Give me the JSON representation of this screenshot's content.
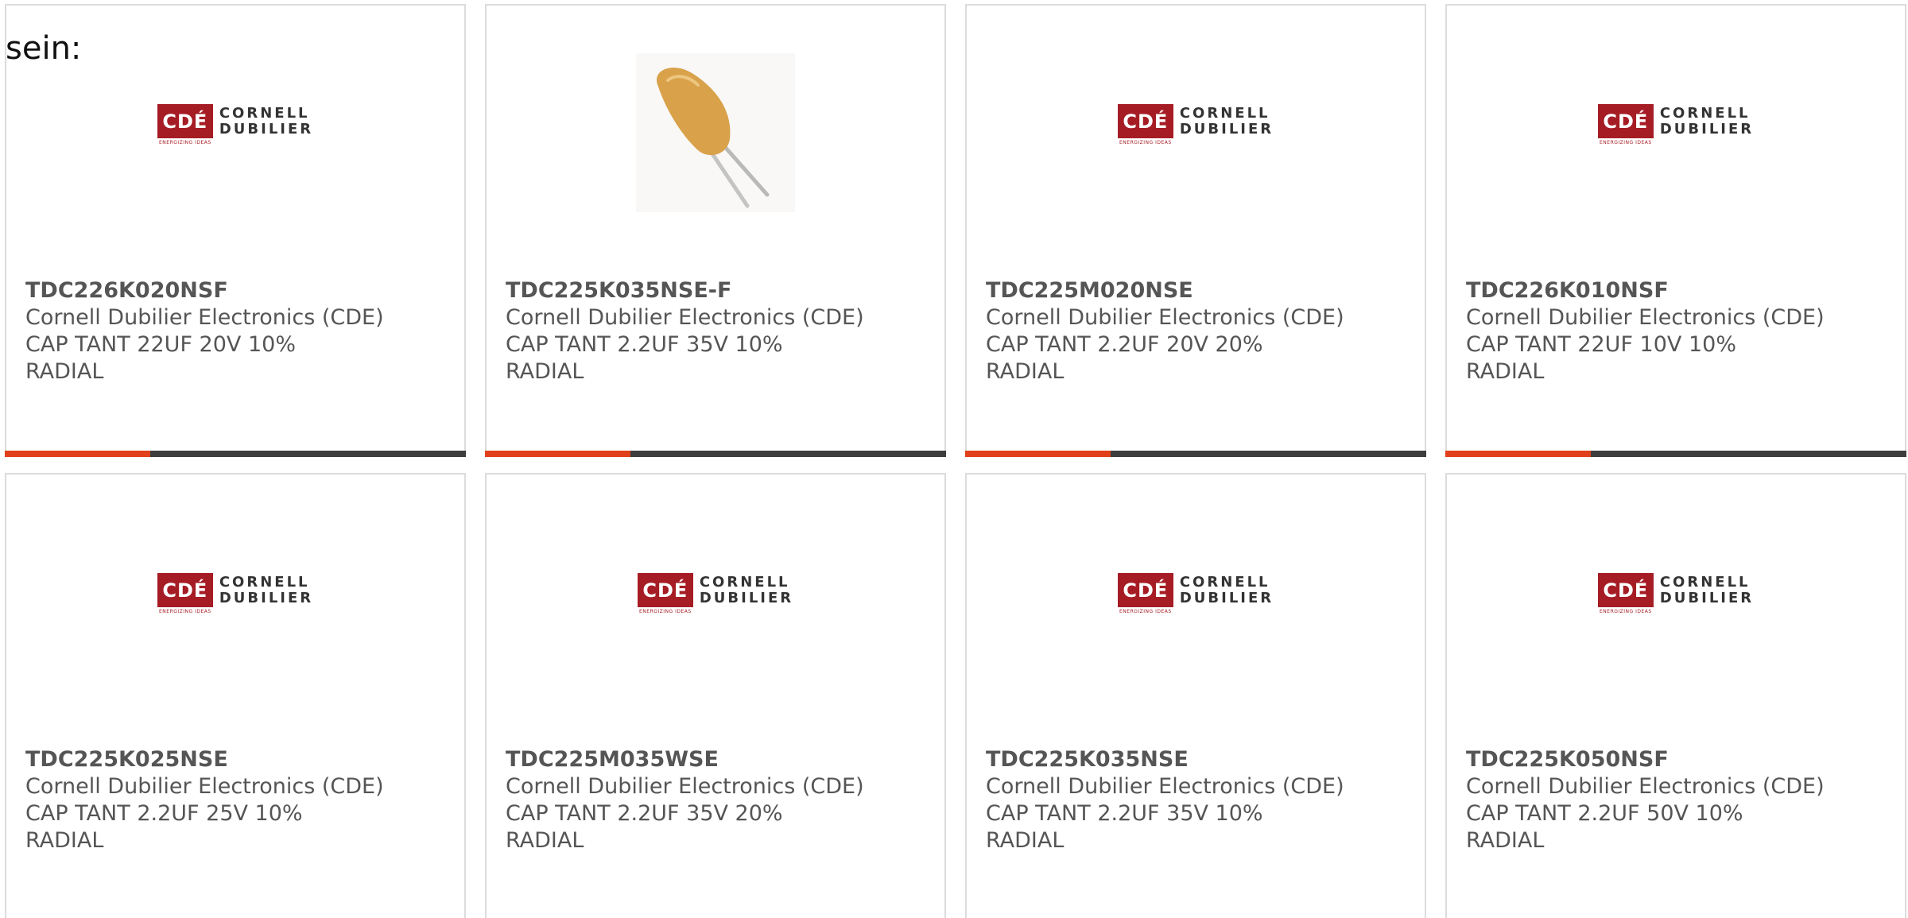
{
  "intro_text": "sein:",
  "colors": {
    "accent": "#e2401c",
    "bar": "#3d3d3d",
    "logo_red": "#a61c24",
    "capacitor_body": "#d9a14a"
  },
  "logo": {
    "mark": "CDÉ",
    "line1": "CORNELL",
    "line2": "DUBILIER",
    "tagline": "ENERGIZING IDEAS"
  },
  "products": [
    {
      "part_number": "TDC226K020NSF",
      "manufacturer": "Cornell Dubilier Electronics (CDE)",
      "desc_line1": "CAP TANT 22UF 20V 10%",
      "desc_line2": "RADIAL",
      "image": "cde-logo"
    },
    {
      "part_number": "TDC225K035NSE-F",
      "manufacturer": "Cornell Dubilier Electronics (CDE)",
      "desc_line1": "CAP TANT 2.2UF 35V 10%",
      "desc_line2": "RADIAL",
      "image": "capacitor-photo"
    },
    {
      "part_number": "TDC225M020NSE",
      "manufacturer": "Cornell Dubilier Electronics (CDE)",
      "desc_line1": "CAP TANT 2.2UF 20V 20%",
      "desc_line2": "RADIAL",
      "image": "cde-logo"
    },
    {
      "part_number": "TDC226K010NSF",
      "manufacturer": "Cornell Dubilier Electronics (CDE)",
      "desc_line1": "CAP TANT 22UF 10V 10%",
      "desc_line2": "RADIAL",
      "image": "cde-logo"
    },
    {
      "part_number": "TDC225K025NSE",
      "manufacturer": "Cornell Dubilier Electronics (CDE)",
      "desc_line1": "CAP TANT 2.2UF 25V 10%",
      "desc_line2": "RADIAL",
      "image": "cde-logo"
    },
    {
      "part_number": "TDC225M035WSE",
      "manufacturer": "Cornell Dubilier Electronics (CDE)",
      "desc_line1": "CAP TANT 2.2UF 35V 20%",
      "desc_line2": "RADIAL",
      "image": "cde-logo"
    },
    {
      "part_number": "TDC225K035NSE",
      "manufacturer": "Cornell Dubilier Electronics (CDE)",
      "desc_line1": "CAP TANT 2.2UF 35V 10%",
      "desc_line2": "RADIAL",
      "image": "cde-logo"
    },
    {
      "part_number": "TDC225K050NSF",
      "manufacturer": "Cornell Dubilier Electronics (CDE)",
      "desc_line1": "CAP TANT 2.2UF 50V 10%",
      "desc_line2": "RADIAL",
      "image": "cde-logo"
    }
  ]
}
